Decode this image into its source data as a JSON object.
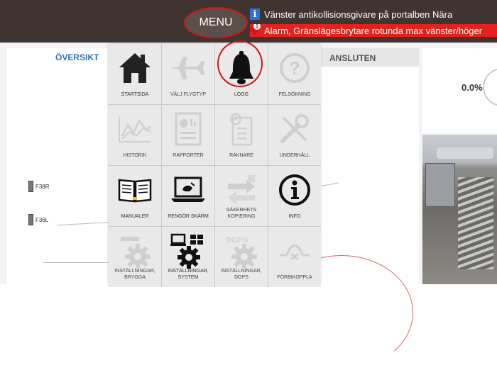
{
  "topbar": {
    "menu_label": "MENU",
    "info_message": "Vänster antikollisionsgivare på portalben Nära",
    "alarm_count": "1",
    "alarm_message": "Alarm, Gränslägesbrytare rotunda max vänster/höger"
  },
  "background": {
    "overview_title": "ÖVERSIKT",
    "status": "ANSLUTEN",
    "percent": "0.0%",
    "planes": [
      "F38R",
      "F36L"
    ]
  },
  "menu": {
    "items": [
      {
        "label": "STARTSIDA",
        "icon": "home-icon",
        "enabled": true
      },
      {
        "label": "VÄLJ FLYGTYP",
        "icon": "airplane-icon",
        "enabled": false
      },
      {
        "label": "LOGG",
        "icon": "bell-icon",
        "enabled": true
      },
      {
        "label": "FELSÖKNING",
        "icon": "question-icon",
        "enabled": false
      },
      {
        "label": "HISTORIK",
        "icon": "chart-icon",
        "enabled": false
      },
      {
        "label": "RAPPORTER",
        "icon": "report-icon",
        "enabled": false
      },
      {
        "label": "RÄKNARE",
        "icon": "counter-icon",
        "enabled": false
      },
      {
        "label": "UNDERHÅLL",
        "icon": "wrench-icon",
        "enabled": false
      },
      {
        "label": "MANUALER",
        "icon": "book-icon",
        "enabled": true
      },
      {
        "label": "RENGÖR SKÄRM",
        "icon": "laptop-clean-icon",
        "enabled": true
      },
      {
        "label": "SÄKERHETS KOPIERING",
        "icon": "backup-icon",
        "enabled": false
      },
      {
        "label": "INFO",
        "icon": "info-icon",
        "enabled": true
      },
      {
        "label": "INSTÄLLNINGAR, BRYGGA",
        "icon": "gear-icon",
        "enabled": false
      },
      {
        "label": "INSTÄLLNINGAR, SYSTEM",
        "icon": "gear-icon",
        "enabled": true
      },
      {
        "label": "INSTÄLLNINGAR, DGPS",
        "icon": "gear-icon",
        "enabled": false
      },
      {
        "label": "FÖRBIKOPPLA",
        "icon": "bypass-icon",
        "enabled": false
      }
    ]
  },
  "colors": {
    "topbar": "#3f3430",
    "alarm": "#e2221d",
    "highlight": "#d01616",
    "accent_blue": "#2f6fba"
  }
}
